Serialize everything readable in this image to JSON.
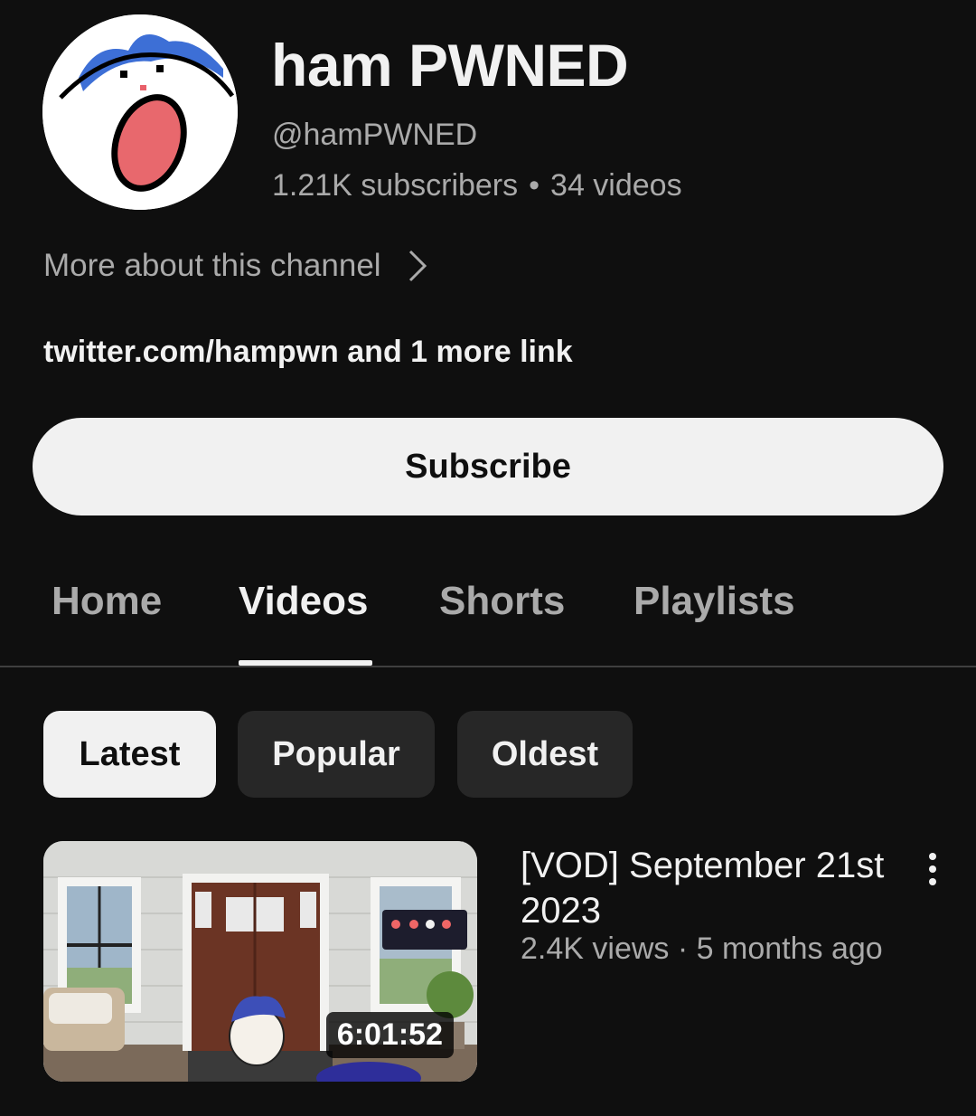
{
  "channel": {
    "name": "ham PWNED",
    "handle": "@hamPWNED",
    "subscribers": "1.21K subscribers",
    "separator": "•",
    "videos": "34 videos",
    "more_about": "More about this channel",
    "links": "twitter.com/hampwn and 1 more link"
  },
  "subscribe": {
    "label": "Subscribe"
  },
  "tabs": [
    {
      "label": "Home",
      "active": false
    },
    {
      "label": "Videos",
      "active": true
    },
    {
      "label": "Shorts",
      "active": false
    },
    {
      "label": "Playlists",
      "active": false
    }
  ],
  "filters": [
    {
      "label": "Latest",
      "selected": true
    },
    {
      "label": "Popular",
      "selected": false
    },
    {
      "label": "Oldest",
      "selected": false
    }
  ],
  "video": {
    "title": "[VOD] September 21st 2023",
    "views": "2.4K views",
    "separator": "·",
    "age": "5 months ago",
    "duration": "6:01:52"
  },
  "icons": {
    "more_chevron": "chevron-right-icon",
    "video_menu": "more-vert-icon"
  },
  "colors": {
    "background": "#0f0f0f",
    "text_primary": "#f1f1f1",
    "text_secondary": "#aaaaaa",
    "chip_bg": "#272727"
  }
}
